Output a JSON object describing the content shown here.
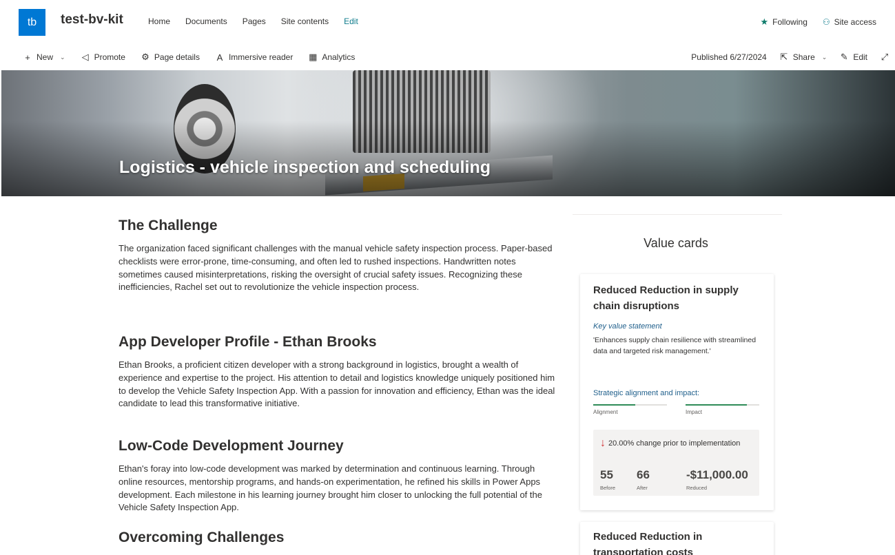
{
  "site": {
    "logo_initials": "tb",
    "title": "test-bv-kit",
    "nav": [
      "Home",
      "Documents",
      "Pages",
      "Site contents",
      "Edit"
    ],
    "following_label": "Following",
    "site_access_label": "Site access"
  },
  "commandbar": {
    "new_label": "New",
    "promote_label": "Promote",
    "page_details_label": "Page details",
    "immersive_reader_label": "Immersive reader",
    "analytics_label": "Analytics",
    "published_label": "Published 6/27/2024",
    "share_label": "Share",
    "edit_label": "Edit"
  },
  "hero": {
    "title": "Logistics - vehicle inspection and scheduling"
  },
  "sections": [
    {
      "heading": "The Challenge",
      "body": "The organization faced significant challenges with the manual vehicle safety inspection process. Paper-based checklists were error-prone, time-consuming, and often led to rushed inspections. Handwritten notes sometimes caused misinterpretations, risking the oversight of crucial safety issues. Recognizing these inefficiencies, Rachel set out to revolutionize the vehicle inspection process."
    },
    {
      "heading": "App Developer Profile - Ethan Brooks",
      "body": "Ethan Brooks, a proficient citizen developer with a strong background in logistics, brought a wealth of experience and expertise to the project. His attention to detail and logistics knowledge uniquely positioned him to develop the Vehicle Safety Inspection App. With a passion for innovation and efficiency, Ethan was the ideal candidate to lead this transformative initiative."
    },
    {
      "heading": "Low-Code Development Journey",
      "body": "Ethan's foray into low-code development was marked by determination and continuous learning. Through online resources, mentorship programs, and hands-on experimentation, he refined his skills in Power Apps development. Each milestone in his learning journey brought him closer to unlocking the full potential of the Vehicle Safety Inspection App."
    },
    {
      "heading": "Overcoming Challenges",
      "body": ""
    }
  ],
  "value_cards": {
    "title": "Value cards",
    "cards": [
      {
        "title": "Reduced Reduction in supply chain disruptions",
        "key_value_label": "Key value statement",
        "key_value_text": "'Enhances supply chain resilience with streamlined data and targeted risk management.'",
        "strategic_label": "Strategic alignment and impact:",
        "alignment_label": "Alignment",
        "alignment_level": 0.57,
        "impact_label": "Impact",
        "impact_level": 0.83,
        "change_text": "20.00% change prior to implementation",
        "before_value": "55",
        "before_label": "Before",
        "after_value": "66",
        "after_label": "After",
        "reduced_value": "-$11,000.00",
        "reduced_label": "Reduced"
      },
      {
        "title": "Reduced Reduction in transportation costs"
      }
    ]
  },
  "colors": {
    "brand": "#0078d4",
    "accent_teal": "#0f7c8c",
    "link_blue": "#1f5f8b",
    "bar_green": "#2e8b57",
    "down_red": "#d13438"
  }
}
